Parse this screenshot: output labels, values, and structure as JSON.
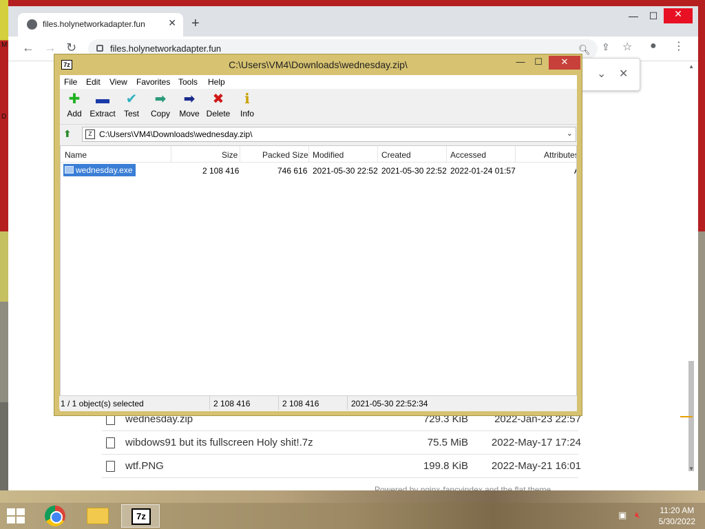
{
  "browser": {
    "tab_title": "files.holynetworkadapter.fun",
    "tab_close": "✕",
    "new_tab": "+",
    "url": "files.holynetworkadapter.fun",
    "window_controls": {
      "minimize": "—",
      "maximize": "☐",
      "close": "✕"
    }
  },
  "desktop": {
    "left_edge_labels": [
      "M",
      "D"
    ]
  },
  "download_popup": {
    "chevron": "⌄",
    "close": "✕"
  },
  "listing": [
    {
      "name": "wednesday.zip",
      "size": "729.3 KiB",
      "date": "2022-Jan-23 22:57"
    },
    {
      "name": "wibdows91 but its fullscreen Holy shit!.7z",
      "size": "75.5 MiB",
      "date": "2022-May-17 17:24"
    },
    {
      "name": "wtf.PNG",
      "size": "199.8 KiB",
      "date": "2022-May-21 16:01"
    }
  ],
  "footer_text": "Powered by nginx-fancyindex and the flat theme",
  "sevenzip": {
    "app_icon": "7z",
    "title": "C:\\Users\\VM4\\Downloads\\wednesday.zip\\",
    "menu": [
      "File",
      "Edit",
      "View",
      "Favorites",
      "Tools",
      "Help"
    ],
    "toolbar": [
      {
        "label": "Add",
        "icon": "plus-icon",
        "glyph": "✚",
        "color": "#20b020"
      },
      {
        "label": "Extract",
        "icon": "minus-icon",
        "glyph": "▬",
        "color": "#1a3aa8"
      },
      {
        "label": "Test",
        "icon": "check-icon",
        "glyph": "✔",
        "color": "#30b0c0"
      },
      {
        "label": "Copy",
        "icon": "copy-arrow-icon",
        "glyph": "➡",
        "color": "#2a9a7a"
      },
      {
        "label": "Move",
        "icon": "move-arrow-icon",
        "glyph": "➡",
        "color": "#1a2a8a"
      },
      {
        "label": "Delete",
        "icon": "delete-x-icon",
        "glyph": "✖",
        "color": "#d01818"
      },
      {
        "label": "Info",
        "icon": "info-icon",
        "glyph": "ℹ",
        "color": "#c8a000"
      }
    ],
    "path": "C:\\Users\\VM4\\Downloads\\wednesday.zip\\",
    "columns": [
      "Name",
      "Size",
      "Packed Size",
      "Modified",
      "Created",
      "Accessed",
      "Attributes"
    ],
    "files": [
      {
        "name": "wednesday.exe",
        "size": "2 108 416",
        "packed": "746 616",
        "modified": "2021-05-30 22:52",
        "created": "2021-05-30 22:52",
        "accessed": "2022-01-24 01:57",
        "attributes": "A"
      }
    ],
    "status": {
      "selected": "1 / 1 object(s) selected",
      "size": "2 108 416",
      "packed": "2 108 416",
      "date": "2021-05-30 22:52:34"
    }
  },
  "taskbar": {
    "time": "11:20 AM",
    "date": "5/30/2022"
  }
}
